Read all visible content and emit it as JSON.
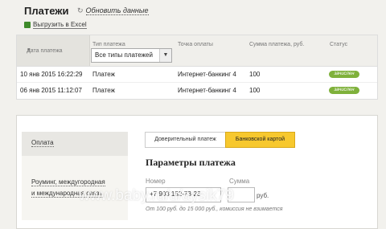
{
  "header": {
    "title": "Платежи",
    "refresh_label": "Обновить данные",
    "excel_label": "Выгрузить в Excel"
  },
  "table": {
    "columns": {
      "date": "Дата платежа",
      "type": "Тип платежа",
      "point": "Точка оплаты",
      "amount": "Сумма платежа, руб.",
      "status": "Статус"
    },
    "type_filter": {
      "selected": "Все типы платежей"
    },
    "rows": [
      {
        "date": "10 янв 2015  16:22:29",
        "type": "Платеж",
        "point": "Интернет-банкинг 4",
        "amount": "100",
        "status": "зачислен"
      },
      {
        "date": "06 янв 2015  11:12:07",
        "type": "Платеж",
        "point": "Интернет-банкинг 4",
        "amount": "100",
        "status": "зачислен"
      }
    ]
  },
  "sidebar": {
    "items": [
      {
        "label": "Оплата"
      },
      {
        "line1": "Роуминг, междугородная",
        "line2": "и международная связь"
      }
    ]
  },
  "tabs": [
    {
      "label": "Доверительный платеж"
    },
    {
      "label": "Банковской картой"
    }
  ],
  "form": {
    "title": "Параметры платежа",
    "number_label": "Номер",
    "number_value": "+7 903 152-73-23",
    "amount_label": "Сумма",
    "amount_value": "",
    "currency": "руб.",
    "note": "От 100 руб. до 15 000 руб., комиссия не взимается"
  },
  "watermark": "www.baby.ru/u/aysik79",
  "colors": {
    "active_tab": "#f7c82e",
    "status_badge": "#7fb13b",
    "excel_icon": "#3e8a2a"
  }
}
